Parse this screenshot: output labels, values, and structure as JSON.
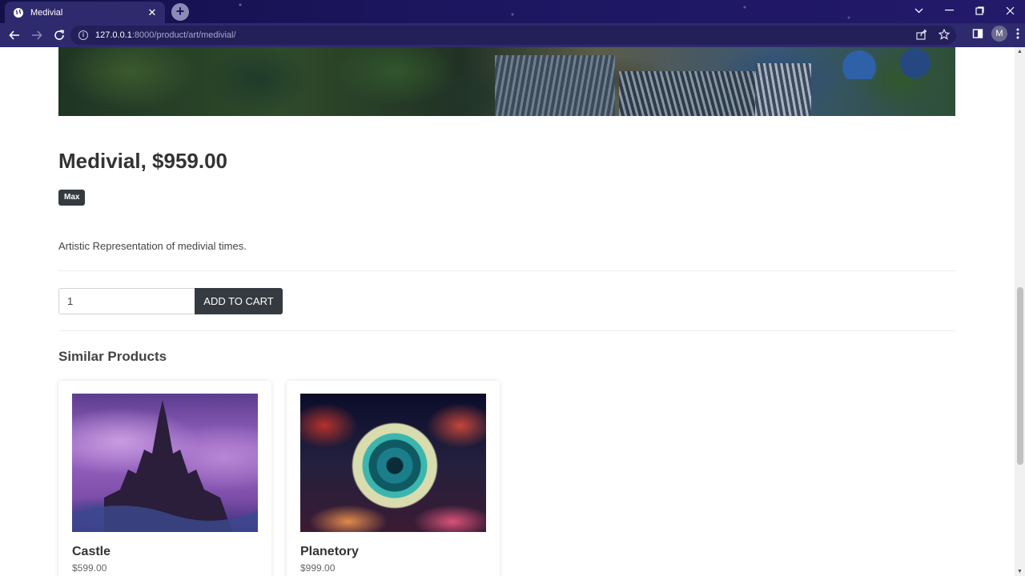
{
  "browser": {
    "tab_title": "Medivial",
    "url_host": "127.0.0.1",
    "url_rest": ":8000/product/art/medivial/",
    "profile_initial": "M"
  },
  "product": {
    "title": "Medivial, $959.00",
    "badge": "Max",
    "description": "Artistic Representation of medivial times.",
    "quantity": "1",
    "add_to_cart_label": "ADD TO CART"
  },
  "similar": {
    "heading": "Similar Products",
    "items": [
      {
        "name": "Castle",
        "price": "$599.00"
      },
      {
        "name": "Planetory",
        "price": "$999.00"
      }
    ]
  },
  "colors": {
    "titlebar": "#1c1660",
    "toolbar": "#2e2a6e",
    "button_dark": "#343a40"
  }
}
